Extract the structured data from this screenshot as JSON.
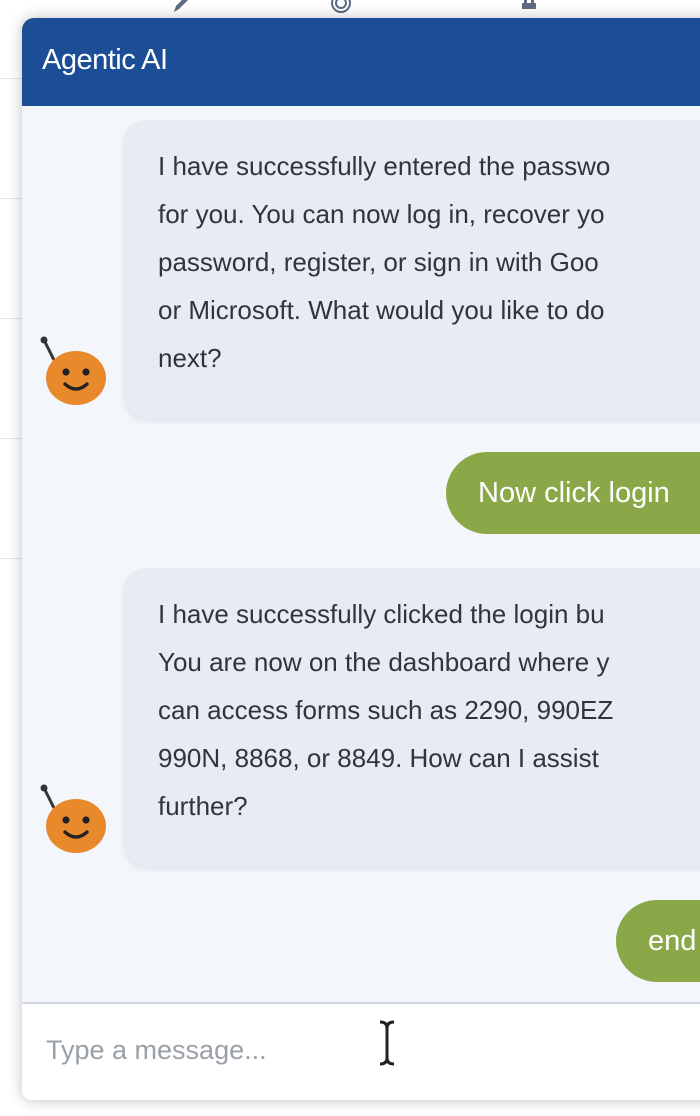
{
  "header": {
    "title": "Agentic AI"
  },
  "messages": [
    {
      "role": "bot",
      "lines": [
        "I have successfully entered the passwo",
        "for you. You can now log in, recover yo",
        "password, register, or sign in with Goo",
        "or Microsoft. What would you like to do",
        "next?"
      ]
    },
    {
      "role": "user",
      "text": "Now click login"
    },
    {
      "role": "bot",
      "lines": [
        "I have successfully clicked the login bu",
        "You are now on the dashboard where y",
        "can access forms such as 2290, 990EZ",
        "990N, 8868, or 8849. How can I assist",
        "further?"
      ]
    },
    {
      "role": "user",
      "text": "end"
    }
  ],
  "composer": {
    "placeholder": "Type a message..."
  },
  "colors": {
    "header": "#1b4e96",
    "bot_bubble": "#e7ebf2",
    "user_bubble": "#8ba848",
    "chat_background": "#f3f7fc",
    "avatar": "#e88a2c"
  },
  "icons": {
    "background_toolbar": [
      "pencil-icon",
      "target-icon",
      "plug-icon"
    ],
    "bot_avatar": "robot-face-icon",
    "cursor": "text-cursor-icon"
  }
}
